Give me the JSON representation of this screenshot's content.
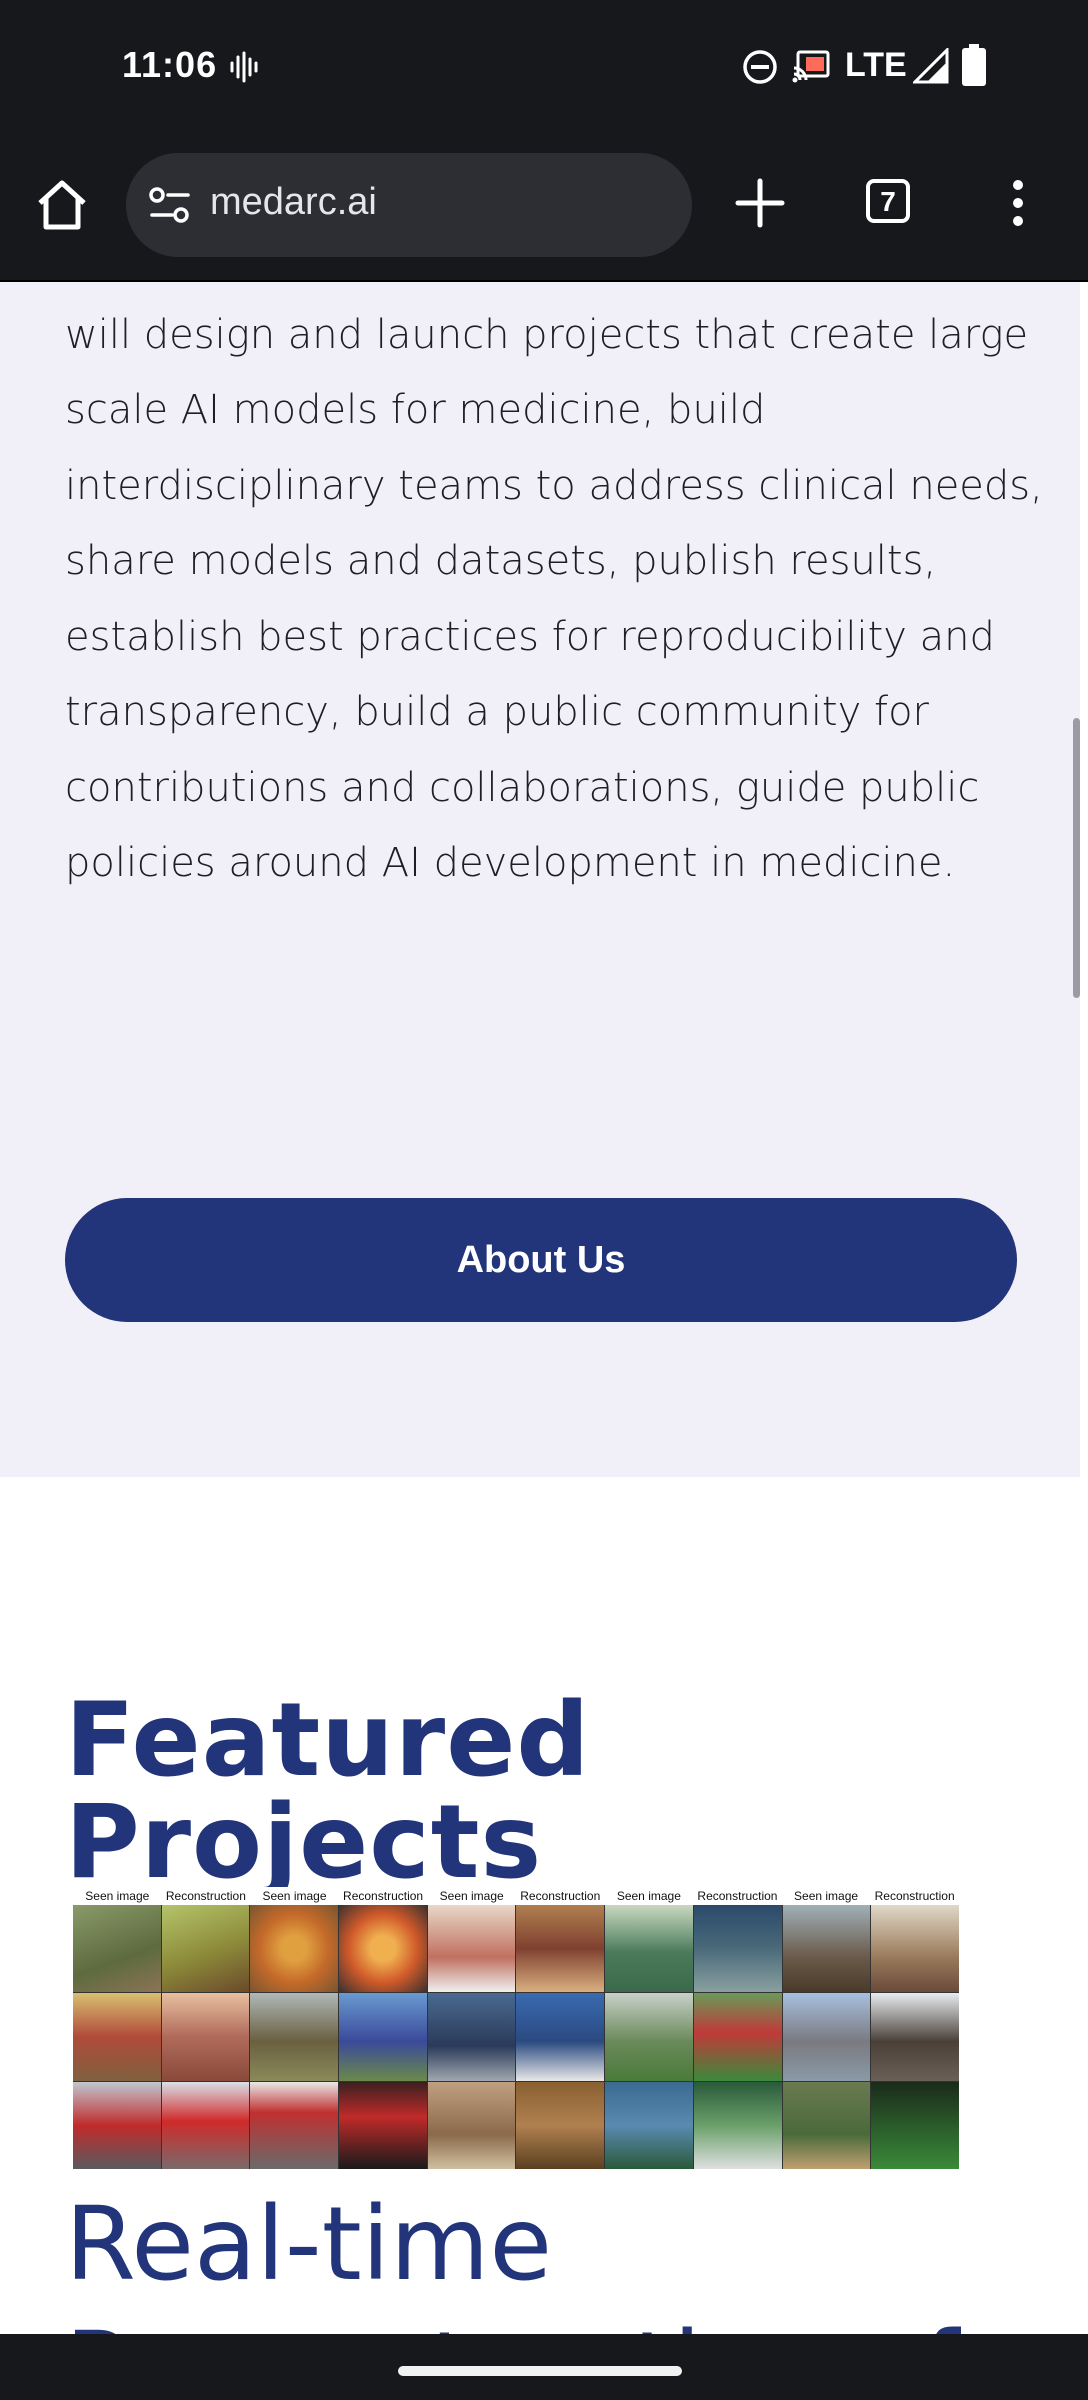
{
  "status_bar": {
    "time": "11:06",
    "network": "LTE",
    "icons": [
      "voice-activity-icon",
      "do-not-disturb-icon",
      "cast-icon",
      "signal-icon",
      "battery-icon"
    ]
  },
  "browser": {
    "url": "medarc.ai",
    "tab_count": "7",
    "icons": [
      "home-icon",
      "site-settings-icon",
      "plus-icon",
      "more-vert-icon"
    ]
  },
  "main": {
    "mission_text": "other researchers and medical professionals, we will design and launch projects that create large scale AI models for medicine, build interdisciplinary teams to address clinical needs, share models and datasets, publish results, establish best practices for reproducibility and transparency, build a public community for contributions and collaborations, guide public policies around AI development in medicine.",
    "about_button": "About Us",
    "featured_title": "Featured Projects",
    "project_figure": {
      "headers": [
        "Seen image",
        "Reconstruction",
        "Seen image",
        "Reconstruction",
        "Seen image",
        "Reconstruction",
        "Seen image",
        "Reconstruction",
        "Seen image",
        "Reconstruction"
      ]
    },
    "project_title": "Real-time Reconstruction of"
  },
  "colors": {
    "brand": "#22347a",
    "section_bg": "#f1f0f8",
    "chrome": "#17181c"
  }
}
